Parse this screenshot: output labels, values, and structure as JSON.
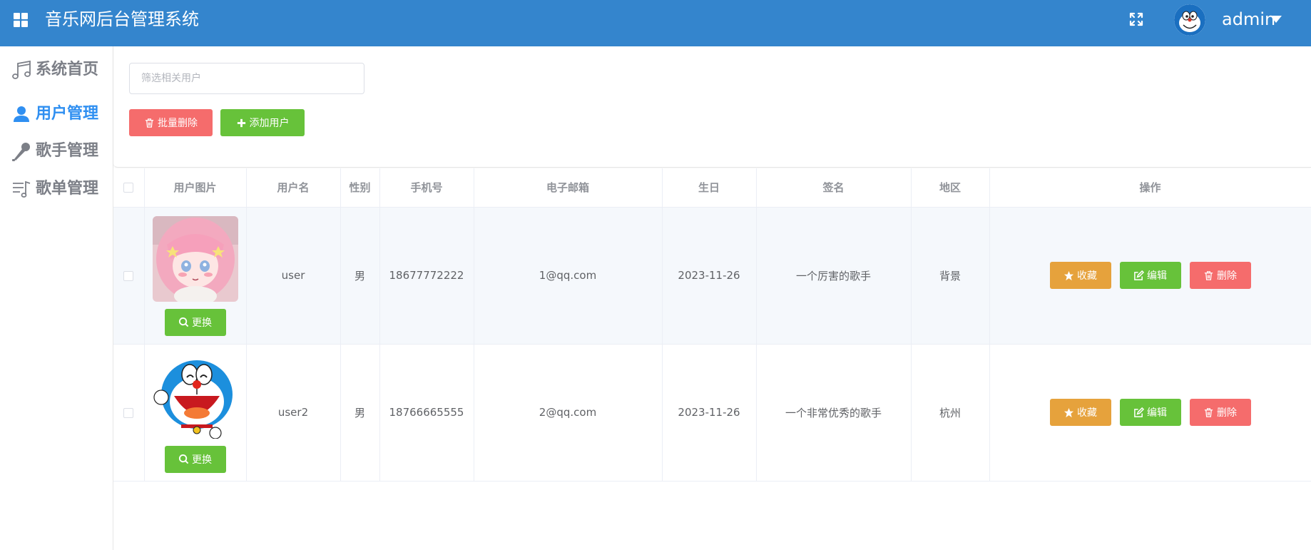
{
  "header": {
    "title": "音乐网后台管理系统",
    "username": "admin",
    "color": "#3485cd"
  },
  "sidebar": {
    "items": [
      {
        "label": "系统首页",
        "icon": "music-note-icon",
        "active": false
      },
      {
        "label": "用户管理",
        "icon": "user-icon",
        "active": true
      },
      {
        "label": "歌手管理",
        "icon": "microphone-icon",
        "active": false
      },
      {
        "label": "歌单管理",
        "icon": "playlist-icon",
        "active": false
      }
    ]
  },
  "toolbar": {
    "search_placeholder": "筛选相关用户",
    "batch_delete_label": "批量删除",
    "add_user_label": "添加用户"
  },
  "table": {
    "columns": [
      "",
      "用户图片",
      "用户名",
      "性别",
      "手机号",
      "电子邮箱",
      "生日",
      "签名",
      "地区",
      "操作"
    ],
    "rows": [
      {
        "pic": "anime-girl-avatar",
        "username": "user",
        "gender": "男",
        "phone": "18677772222",
        "email": "1@qq.com",
        "birthday": "2023-11-26",
        "signature": "一个厉害的歌手",
        "region": "背景"
      },
      {
        "pic": "doraemon-avatar",
        "username": "user2",
        "gender": "男",
        "phone": "18766665555",
        "email": "2@qq.com",
        "birthday": "2023-11-26",
        "signature": "一个非常优秀的歌手",
        "region": "杭州"
      }
    ],
    "change_label": "更换",
    "favorite_label": "收藏",
    "edit_label": "编辑",
    "delete_label": "删除"
  }
}
